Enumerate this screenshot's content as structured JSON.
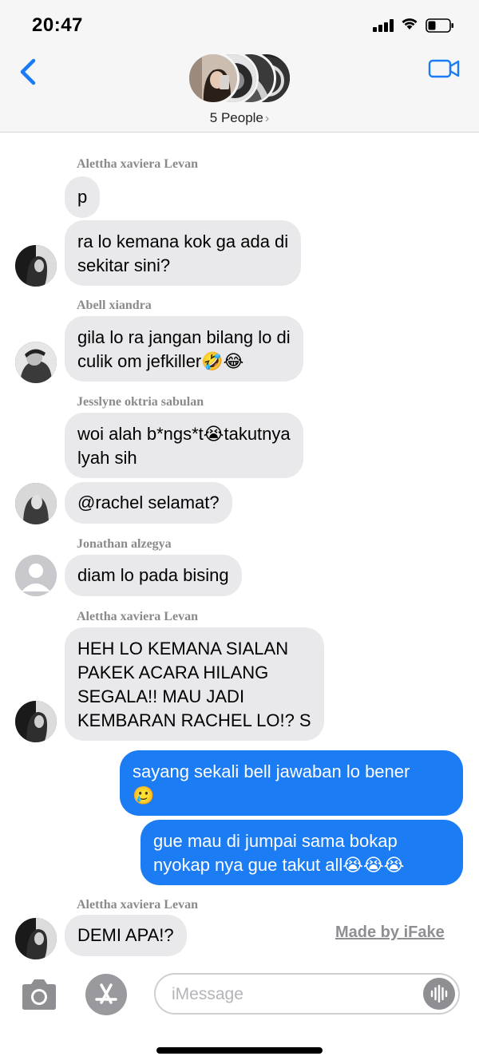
{
  "status": {
    "time": "20:47"
  },
  "header": {
    "people_label": "5 People",
    "chevron": "›"
  },
  "messages": [
    {
      "sender": "Alettha xaviera Levan",
      "lines": [
        "p"
      ]
    },
    {
      "lines": [
        "ra lo kemana kok ga ada di",
        "sekitar sini?"
      ]
    },
    {
      "sender": "Abell xiandra",
      "lines": [
        "gila lo ra jangan bilang lo di",
        "culik om jefkiller🤣😂"
      ]
    },
    {
      "sender": "Jesslyne oktria sabulan",
      "lines": [
        "woi alah b*ngs*t😭takutnya",
        "lyah sih"
      ]
    },
    {
      "lines": [
        "@rachel selamat?"
      ]
    },
    {
      "sender": "Jonathan alzegya",
      "lines": [
        "diam lo pada bising"
      ]
    },
    {
      "sender": "Alettha xaviera Levan",
      "lines": [
        "HEH LO KEMANA SIALAN",
        "PAKEK ACARA HILANG",
        "SEGALA!! MAU JADI",
        "KEMBARAN RACHEL LO!? S"
      ]
    },
    {
      "lines": [
        "sayang sekali bell jawaban lo bener",
        "🥲"
      ]
    },
    {
      "lines": [
        "gue mau di jumpai sama bokap",
        "nyokap nya gue takut all😭😭😭"
      ]
    },
    {
      "sender": "Alettha xaviera Levan",
      "lines": [
        "DEMI APA!?"
      ]
    }
  ],
  "watermark": "Made by iFake",
  "input": {
    "placeholder": "iMessage"
  },
  "colors": {
    "incoming": "#e9e9eb",
    "outgoing": "#1c7cf4",
    "accent": "#1a7cf5"
  }
}
